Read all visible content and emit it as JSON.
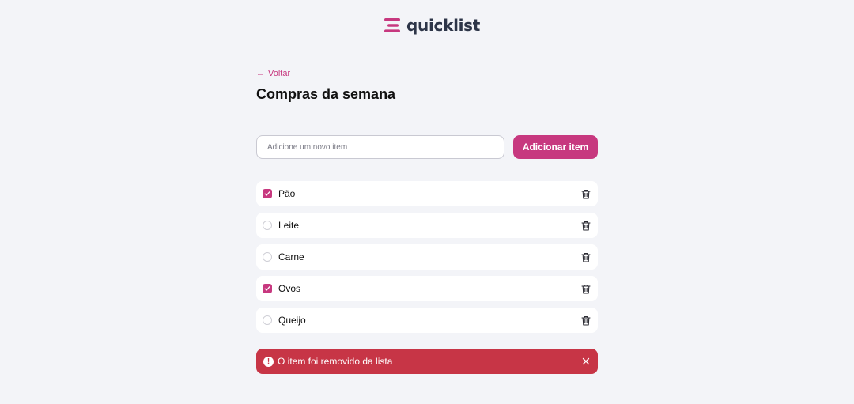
{
  "header": {
    "logo_text": "quicklist",
    "logo_icon": "list-lines-icon",
    "brand_color": "#c7387f"
  },
  "nav": {
    "back_label": "Voltar",
    "back_icon": "arrow-left-icon"
  },
  "page": {
    "title": "Compras da semana"
  },
  "add_form": {
    "input_value": "",
    "input_placeholder": "Adicione um novo item",
    "button_label": "Adicionar item"
  },
  "items": [
    {
      "label": "Pão",
      "checked": true
    },
    {
      "label": "Leite",
      "checked": false
    },
    {
      "label": "Carne",
      "checked": false
    },
    {
      "label": "Ovos",
      "checked": true
    },
    {
      "label": "Queijo",
      "checked": false
    }
  ],
  "item_delete_icon": "trash-icon",
  "toast": {
    "message": "O item foi removido da lista",
    "icon": "alert-circle-icon",
    "icon_glyph": "!",
    "close_icon": "close-icon",
    "background": "#c73546"
  }
}
